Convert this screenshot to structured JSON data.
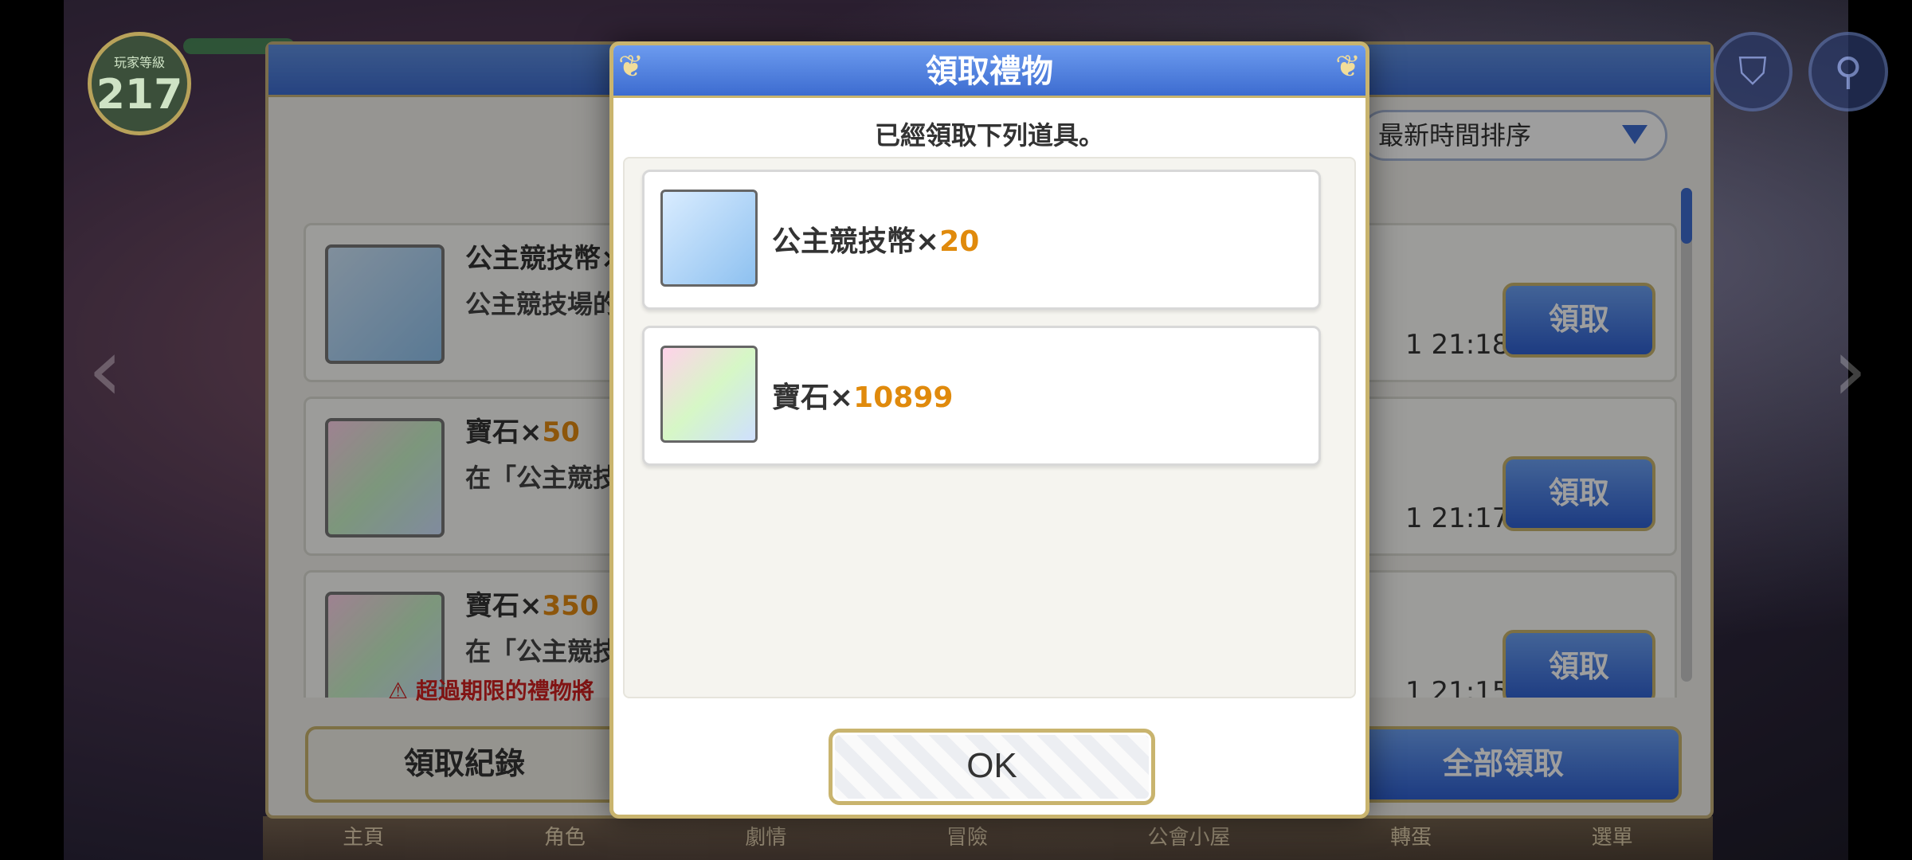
{
  "background": {
    "level_label": "玩家等級",
    "level_value": "217",
    "bottom_nav": [
      "主頁",
      "角色",
      "劇情",
      "冒險",
      "公會小屋",
      "轉蛋",
      "選單"
    ]
  },
  "gift_panel": {
    "sort_label": "最新時間排序",
    "rows": [
      {
        "title": "公主競技幣×",
        "qty": "",
        "desc": "公主競技場的",
        "time": "1 21:18",
        "button": "領取",
        "icon": "arena-coin-icon"
      },
      {
        "title": "寶石×",
        "qty": "50",
        "desc": "在「公主競技",
        "time": "1 21:17",
        "button": "領取",
        "icon": "gem-icon"
      },
      {
        "title": "寶石×",
        "qty": "350",
        "desc": "在「公主競技",
        "time": "1 21:15",
        "button": "領取",
        "icon": "gem-icon"
      }
    ],
    "expire_note": "超過期限的禮物將",
    "history_button": "領取紀錄",
    "claim_all_button": "全部領取"
  },
  "modal": {
    "title": "領取禮物",
    "message": "已經領取下列道具。",
    "items": [
      {
        "name": "公主競技幣×",
        "qty": "20",
        "icon": "arena-coin-icon"
      },
      {
        "name": "寶石×",
        "qty": "10899",
        "icon": "gem-icon"
      }
    ],
    "ok_button": "OK"
  },
  "colors": {
    "accent_blue": "#3d6cd0",
    "gold_border": "#c9b46e",
    "quantity_orange": "#e08a0c"
  }
}
